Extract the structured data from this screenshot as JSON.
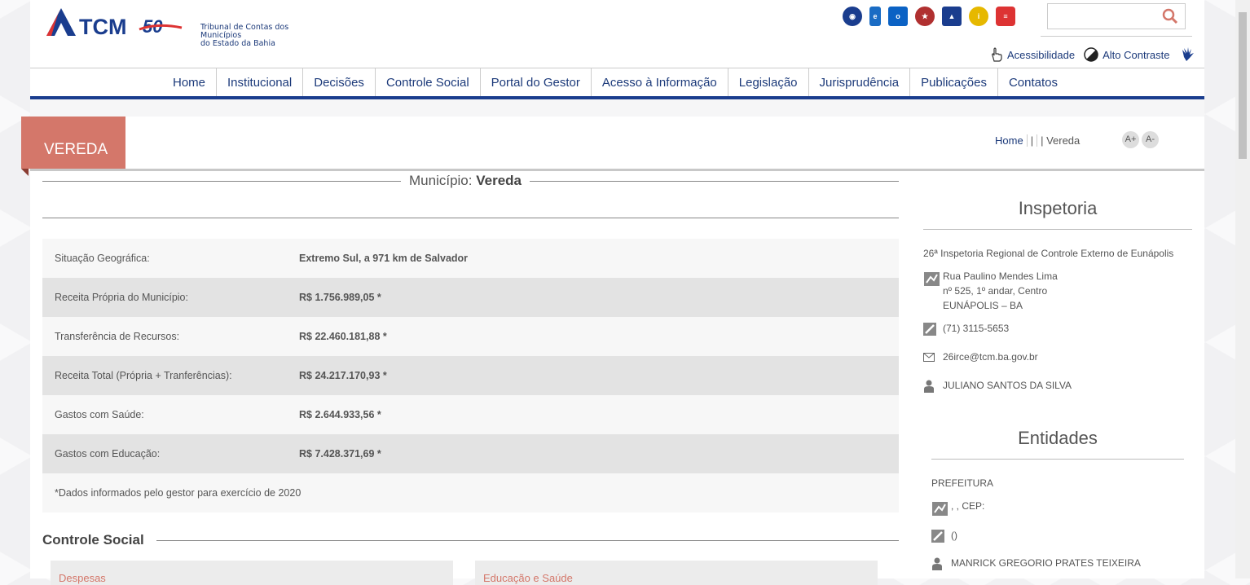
{
  "header": {
    "logo_text": "TCM",
    "logo_50": "50",
    "logo_subtitle_1": "Tribunal de Contas dos Municípios",
    "logo_subtitle_2": "do Estado da Bahia",
    "search_placeholder": "",
    "accessibility_label": "Acessibilidade",
    "contrast_label": "Alto Contraste"
  },
  "nav": {
    "items": [
      "Home",
      "Institucional",
      "Decisões",
      "Controle Social",
      "Portal do Gestor",
      "Acesso à Informação",
      "Legislação",
      "Jurisprudência",
      "Publicações",
      "Contatos"
    ]
  },
  "page": {
    "title": "VEREDA",
    "breadcrumb_home": "Home",
    "breadcrumb_sep": "|",
    "breadcrumb_current": "| Vereda",
    "font_increase": "A+",
    "font_decrease": "A-"
  },
  "municipio": {
    "label": "Município:",
    "name": "Vereda",
    "rows": [
      {
        "key": "Situação Geográfica:",
        "value": "Extremo Sul, a 971 km de Salvador"
      },
      {
        "key": "Receita Própria do Município:",
        "value": "R$ 1.756.989,05 *"
      },
      {
        "key": "Transferência de Recursos:",
        "value": "R$ 22.460.181,88 *"
      },
      {
        "key": "Receita Total (Própria + Tranferências):",
        "value": "R$ 24.217.170,93 *"
      },
      {
        "key": "Gastos com Saúde:",
        "value": "R$ 2.644.933,56 *"
      },
      {
        "key": "Gastos com Educação:",
        "value": "R$ 7.428.371,69 *"
      }
    ],
    "footnote": "*Dados informados pelo gestor para exercício de 2020"
  },
  "controle_social": {
    "title": "Controle Social",
    "cards": [
      "Despesas",
      "Educação e Saúde"
    ]
  },
  "inspetoria": {
    "title": "Inspetoria",
    "name": "26ª Inspetoria Regional de Controle Externo de Eunápolis",
    "address_1": "Rua Paulino Mendes Lima",
    "address_2": "nº 525, 1º andar, Centro",
    "address_3": "EUNÁPOLIS – BA",
    "phone": "(71) 3115-5653",
    "email": "26irce@tcm.ba.gov.br",
    "person": "JULIANO SANTOS DA SILVA"
  },
  "entidades": {
    "title": "Entidades",
    "type": "PREFEITURA",
    "address": ", , CEP:",
    "phone": "()",
    "person": "MANRICK GREGORIO PRATES TEIXEIRA"
  },
  "colors": {
    "brand_blue": "#1a3d8e",
    "accent_red": "#d4776a"
  }
}
